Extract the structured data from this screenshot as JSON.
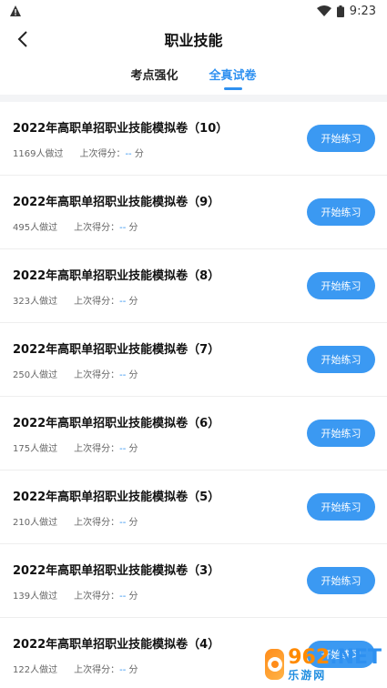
{
  "status_bar": {
    "time": "9:23",
    "warning_icon": "warning-icon",
    "wifi_icon": "wifi-icon",
    "battery_icon": "battery-icon"
  },
  "header": {
    "title": "职业技能",
    "back_icon": "back-arrow-icon"
  },
  "tabs": [
    {
      "label": "考点强化",
      "active": false
    },
    {
      "label": "全真试卷",
      "active": true
    }
  ],
  "colors": {
    "accent": "#2e90f0",
    "button": "#3b99f2"
  },
  "papers": [
    {
      "title": "2022年高职单招职业技能模拟卷（10）",
      "done": "1169人做过",
      "score_label": "上次得分：",
      "score": "--",
      "unit": "分",
      "button": "开始练习"
    },
    {
      "title": "2022年高职单招职业技能模拟卷（9）",
      "done": "495人做过",
      "score_label": "上次得分：",
      "score": "--",
      "unit": "分",
      "button": "开始练习"
    },
    {
      "title": "2022年高职单招职业技能模拟卷（8）",
      "done": "323人做过",
      "score_label": "上次得分：",
      "score": "--",
      "unit": "分",
      "button": "开始练习"
    },
    {
      "title": "2022年高职单招职业技能模拟卷（7）",
      "done": "250人做过",
      "score_label": "上次得分：",
      "score": "--",
      "unit": "分",
      "button": "开始练习"
    },
    {
      "title": "2022年高职单招职业技能模拟卷（6）",
      "done": "175人做过",
      "score_label": "上次得分：",
      "score": "--",
      "unit": "分",
      "button": "开始练习"
    },
    {
      "title": "2022年高职单招职业技能模拟卷（5）",
      "done": "210人做过",
      "score_label": "上次得分：",
      "score": "--",
      "unit": "分",
      "button": "开始练习"
    },
    {
      "title": "2022年高职单招职业技能模拟卷（3）",
      "done": "139人做过",
      "score_label": "上次得分：",
      "score": "--",
      "unit": "分",
      "button": "开始练习"
    },
    {
      "title": "2022年高职单招职业技能模拟卷（4）",
      "done": "122人做过",
      "score_label": "上次得分：",
      "score": "--",
      "unit": "分",
      "button": "开始练习"
    }
  ],
  "watermark": {
    "brand": "962",
    "suffix": ".NET",
    "sub": "乐游网"
  }
}
